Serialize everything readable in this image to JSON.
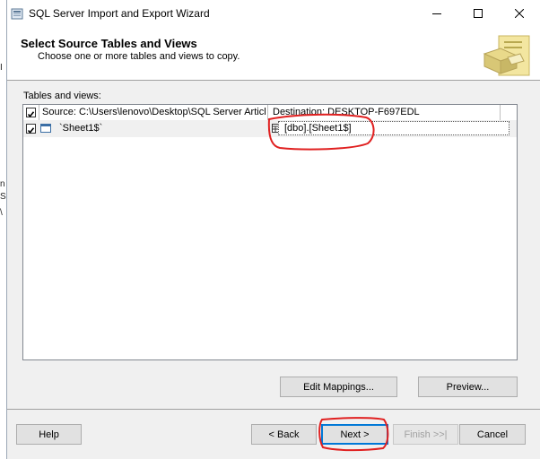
{
  "window": {
    "title": "SQL Server Import and Export Wizard"
  },
  "header": {
    "title": "Select Source Tables and Views",
    "subtitle": "Choose one or more tables and views to copy."
  },
  "tables_label": "Tables and views:",
  "grid": {
    "columns": {
      "source": "Source: C:\\Users\\lenovo\\Desktop\\SQL Server Articl...",
      "destination": "Destination: DESKTOP-F697EDL"
    },
    "header_checked": true,
    "rows": [
      {
        "checked": true,
        "source": "`Sheet1$`",
        "destination": "[dbo].[Sheet1$]"
      }
    ]
  },
  "buttons": {
    "edit_mappings": "Edit Mappings...",
    "preview": "Preview...",
    "help": "Help",
    "back": "< Back",
    "next": "Next >",
    "finish": "Finish >>|",
    "cancel": "Cancel"
  },
  "annotation_color": "#e02020"
}
